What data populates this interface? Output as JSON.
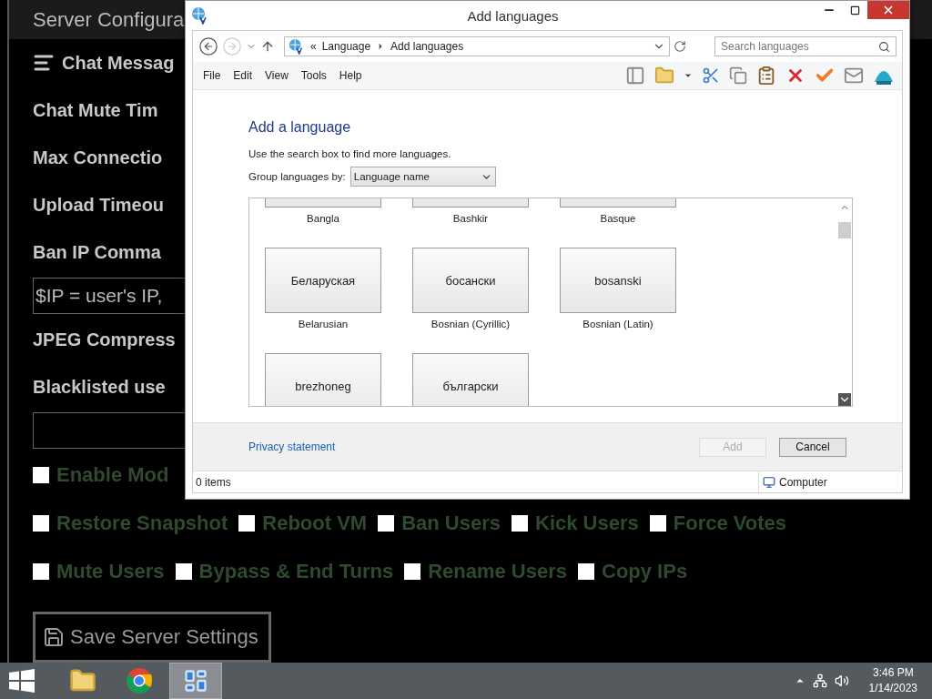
{
  "page": {
    "header": "Server Configura",
    "sections": [
      {
        "kind": "heading",
        "label": "Chat Messag"
      },
      {
        "kind": "label",
        "label": "Chat Mute Tim"
      },
      {
        "kind": "label",
        "label": "Max Connectio"
      },
      {
        "kind": "label",
        "label": "Upload Timeou"
      },
      {
        "kind": "label",
        "label": "Ban IP Comma"
      },
      {
        "kind": "input",
        "value": "$IP = user's IP,"
      },
      {
        "kind": "label",
        "label": "JPEG Compress"
      },
      {
        "kind": "label",
        "label": "Blacklisted use"
      },
      {
        "kind": "input"
      }
    ],
    "checkbox_rows": [
      [
        {
          "label": "Enable Mod",
          "checked": false
        }
      ],
      [
        {
          "label": "Restore Snapshot",
          "checked": false
        },
        {
          "label": "Reboot VM",
          "checked": false
        },
        {
          "label": "Ban Users",
          "checked": false
        },
        {
          "label": "Kick Users",
          "checked": false
        },
        {
          "label": "Force Votes",
          "checked": false
        }
      ],
      [
        {
          "label": "Mute Users",
          "checked": false
        },
        {
          "label": "Bypass & End Turns",
          "checked": false
        },
        {
          "label": "Rename Users",
          "checked": false
        },
        {
          "label": "Copy IPs",
          "checked": false
        }
      ]
    ],
    "save_button": "Save Server Settings"
  },
  "dialog": {
    "title": "Add languages",
    "overflow_mark": "«",
    "breadcrumb": [
      "Language",
      "Add languages"
    ],
    "search": {
      "placeholder": "Search languages"
    },
    "menu": [
      "File",
      "Edit",
      "View",
      "Tools",
      "Help"
    ],
    "heading": "Add a language",
    "hint": "Use the search box to find more languages.",
    "group_by": {
      "label": "Group languages by:",
      "value": "Language name"
    },
    "languages": [
      {
        "name": "Bangla"
      },
      {
        "name": "Bashkir"
      },
      {
        "name": "Basque"
      },
      {
        "native": "Беларуская",
        "name": "Belarusian"
      },
      {
        "native": "босански",
        "name": "Bosnian (Cyrillic)"
      },
      {
        "native": "bosanski",
        "name": "Bosnian (Latin)"
      },
      {
        "native": "brezhoneg"
      },
      {
        "native": "български"
      }
    ],
    "privacy_link": "Privacy statement",
    "buttons": [
      {
        "label": "Add",
        "disabled": true
      },
      {
        "label": "Cancel",
        "disabled": false
      }
    ],
    "status": {
      "items": "0 items",
      "location": "Computer"
    }
  },
  "taskbar": {
    "apps": [
      {
        "kind": "folder",
        "selected": false
      },
      {
        "kind": "browser",
        "selected": false
      },
      {
        "kind": "panel",
        "selected": true
      }
    ],
    "time": "3:46 PM",
    "date": "1/14/2023"
  }
}
